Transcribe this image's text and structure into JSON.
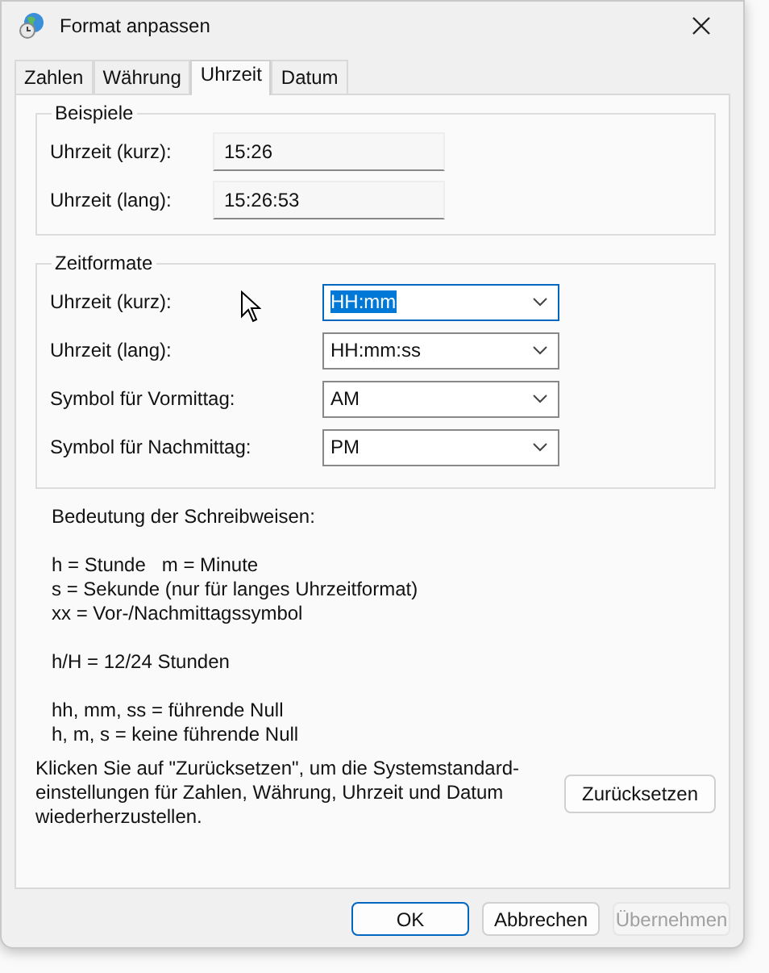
{
  "window": {
    "title": "Format anpassen"
  },
  "tabs": [
    {
      "label": "Zahlen",
      "selected": false
    },
    {
      "label": "Währung",
      "selected": false
    },
    {
      "label": "Uhrzeit",
      "selected": true
    },
    {
      "label": "Datum",
      "selected": false
    }
  ],
  "examples": {
    "title": "Beispiele",
    "rows": [
      {
        "label": "Uhrzeit (kurz):",
        "value": "15:26"
      },
      {
        "label": "Uhrzeit (lang):",
        "value": "15:26:53"
      }
    ]
  },
  "formats": {
    "title": "Zeitformate",
    "rows": [
      {
        "label": "Uhrzeit (kurz):",
        "value": "HH:mm",
        "focused": true
      },
      {
        "label": "Uhrzeit (lang):",
        "value": "HH:mm:ss",
        "focused": false
      },
      {
        "label": "Symbol für Vormittag:",
        "value": "AM",
        "focused": false
      },
      {
        "label": "Symbol für Nachmittag:",
        "value": "PM",
        "focused": false
      }
    ]
  },
  "legend": {
    "title": "Bedeutung der Schreibweisen:",
    "groups": [
      [
        "h = Stunde   m = Minute",
        "s = Sekunde (nur für langes Uhrzeitformat)",
        "xx = Vor-/Nachmittagssymbol"
      ],
      [
        "h/H = 12/24 Stunden"
      ],
      [
        "hh, mm, ss = führende Null",
        "h, m, s = keine führende Null"
      ]
    ]
  },
  "reset": {
    "text": "Klicken Sie auf \"Zurücksetzen\", um die Systemstandard-einstellungen für Zahlen, Währung, Uhrzeit und Datum wiederherzustellen.",
    "button": "Zurücksetzen"
  },
  "buttons": [
    {
      "label": "OK",
      "default": true,
      "disabled": false
    },
    {
      "label": "Abbrechen",
      "default": false,
      "disabled": false
    },
    {
      "label": "Übernehmen",
      "default": false,
      "disabled": true
    }
  ]
}
